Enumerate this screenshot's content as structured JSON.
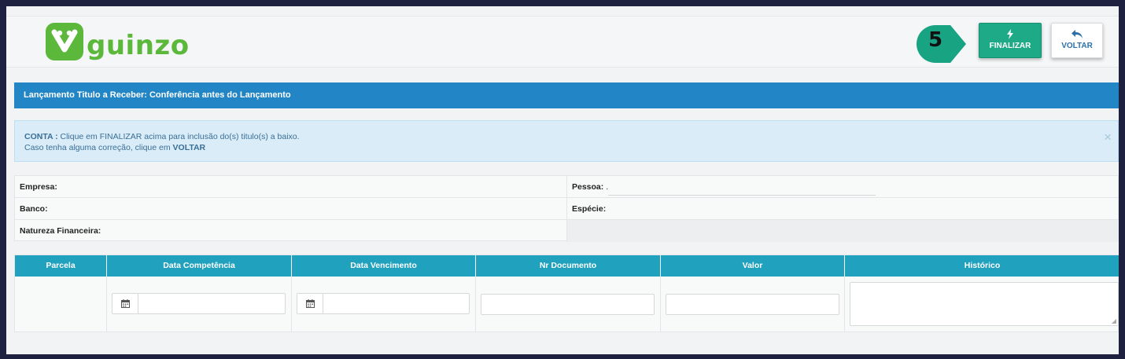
{
  "brand": {
    "name": "guinzo",
    "color": "#5cb83a"
  },
  "step": {
    "number": "5",
    "color": "#18a383"
  },
  "toolbar": {
    "finalize_label": "FINALIZAR",
    "back_label": "VOLTAR"
  },
  "page": {
    "title": "Lançamento Titulo a Receber: Conferência antes do Lançamento"
  },
  "alert": {
    "label": "CONTA :",
    "line1": "Clique em FINALIZAR acima para inclusão do(s) titulo(s) a baixo.",
    "line2_prefix": "Caso tenha alguma correção, clique em",
    "line2_action": "VOLTAR",
    "close": "×"
  },
  "info": {
    "empresa_label": "Empresa:",
    "pessoa_label": "Pessoa:",
    "pessoa_value": ".",
    "banco_label": "Banco:",
    "especie_label": "Espécie:",
    "natureza_label": "Natureza Financeira:"
  },
  "table": {
    "headers": [
      "Parcela",
      "Data Competência",
      "Data Vencimento",
      "Nr Documento",
      "Valor",
      "Histórico"
    ],
    "row": {
      "parcela": "",
      "data_competencia": "",
      "data_vencimento": "",
      "nr_documento": "",
      "valor": "",
      "historico": ""
    }
  },
  "colors": {
    "titlebar": "#2185c6",
    "table_header": "#20a1bd",
    "finalize": "#1eaa87",
    "back_text": "#2c6fa9"
  }
}
